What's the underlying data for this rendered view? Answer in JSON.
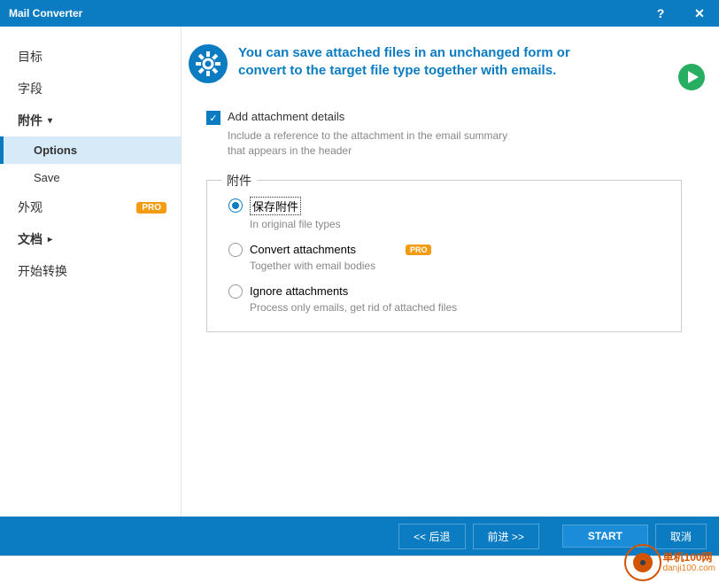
{
  "titlebar": {
    "title": "Mail Converter"
  },
  "sidebar": {
    "items": [
      {
        "label": "目标"
      },
      {
        "label": "字段"
      },
      {
        "label": "附件",
        "expanded": true
      },
      {
        "label": "外观",
        "pro": "PRO"
      },
      {
        "label": "文档"
      },
      {
        "label": "开始转换"
      }
    ],
    "subitems": [
      {
        "label": "Options"
      },
      {
        "label": "Save"
      }
    ]
  },
  "header": {
    "text": "You can save attached files in an unchanged form or convert to the target file type together with emails."
  },
  "checkbox": {
    "label": "Add attachment details",
    "desc": "Include a reference to the attachment in the email summary that appears in the header"
  },
  "fieldset": {
    "legend": "附件",
    "options": [
      {
        "label": "保存附件",
        "desc": "In original file types"
      },
      {
        "label": "Convert attachments",
        "desc": "Together with email bodies",
        "pro": "PRO"
      },
      {
        "label": "Ignore attachments",
        "desc": "Process only emails, get rid of attached files"
      }
    ]
  },
  "footer": {
    "back": "<<  后退",
    "next": "前进  >>",
    "start": "START",
    "cancel": "取消"
  },
  "watermark": {
    "top": "单机100网",
    "bot": "danji100.com"
  }
}
